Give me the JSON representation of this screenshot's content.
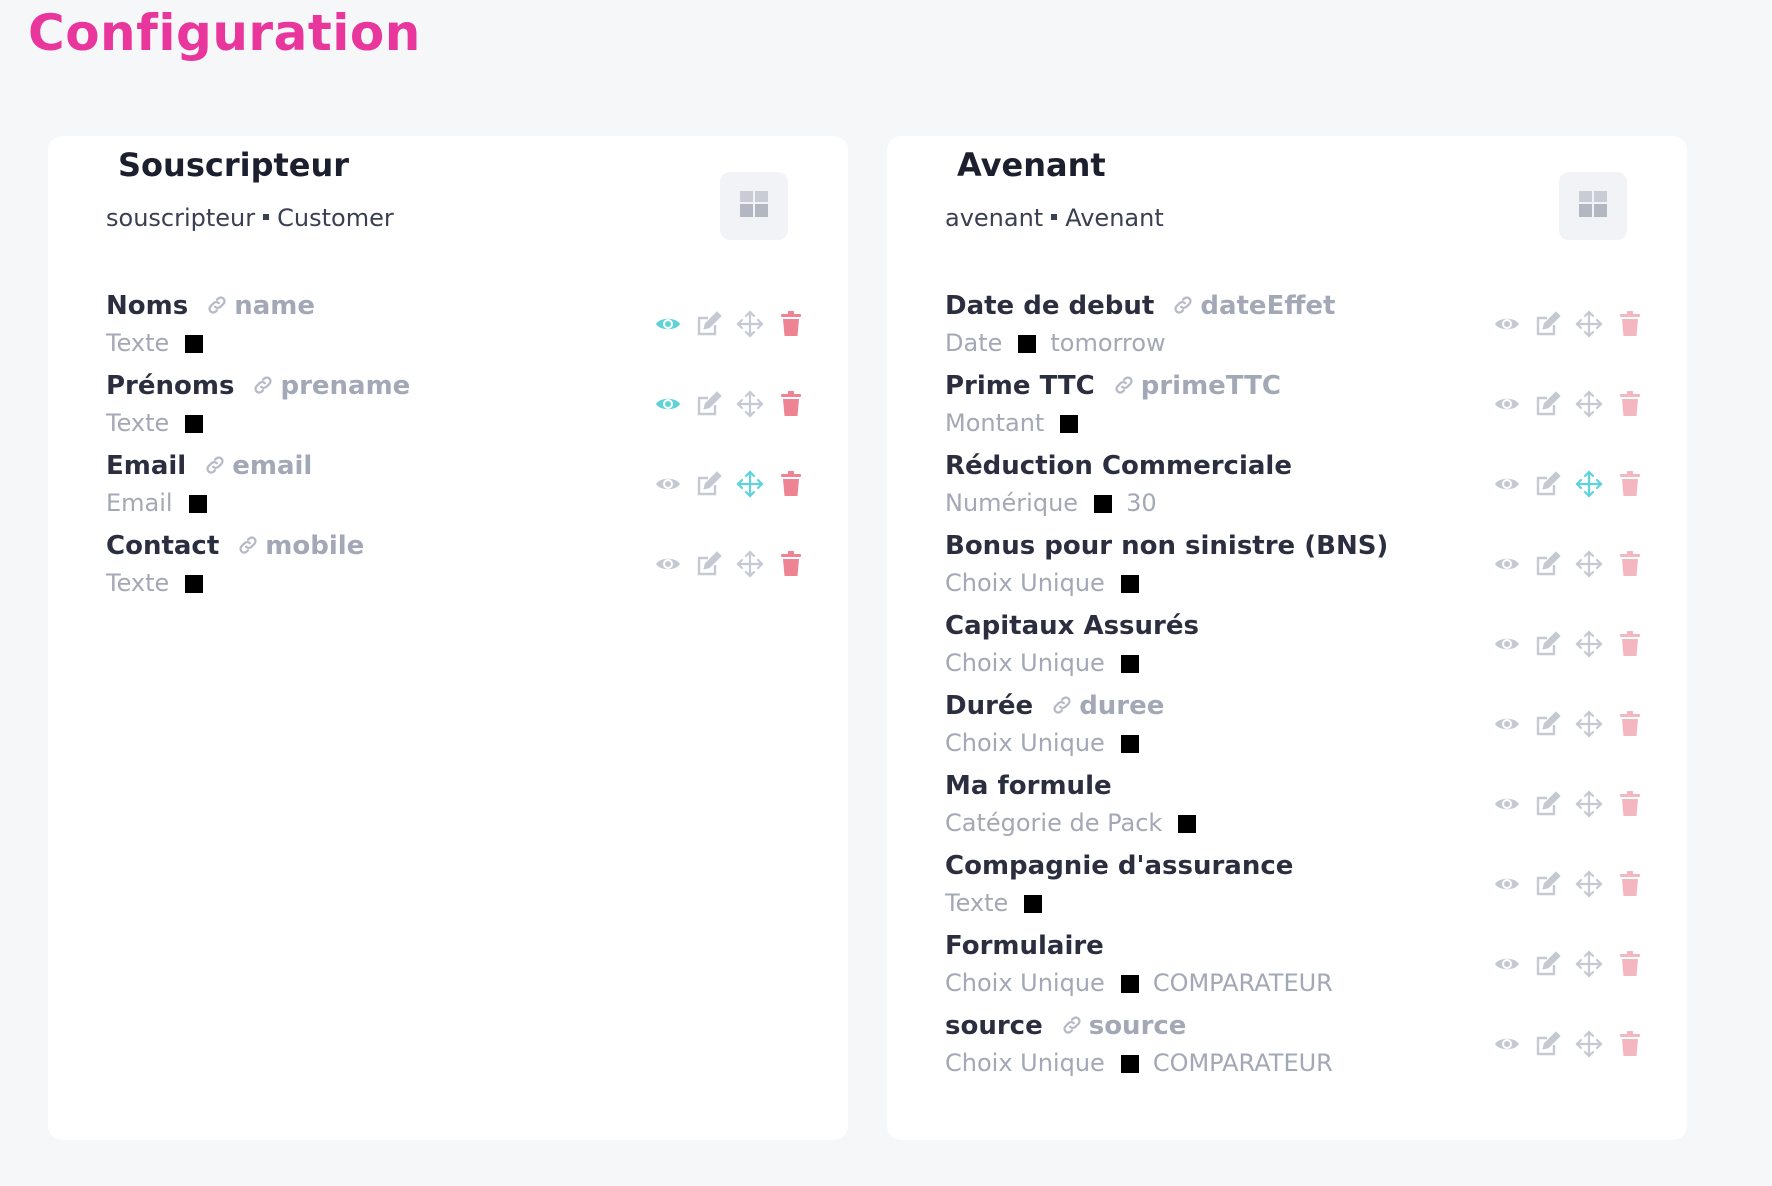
{
  "page_title": "Configuration",
  "colors": {
    "accent": "#e8369c",
    "active_teal": "#5fd2dc",
    "muted_icon": "#c5c9d3",
    "delete_active": "#ee8493",
    "delete_muted": "#f4b6c0"
  },
  "cards": [
    {
      "title": "Souscripteur",
      "key": "souscripteur",
      "entity": "Customer",
      "fields": [
        {
          "name": "Noms",
          "link": "name",
          "type": "Texte",
          "value": "",
          "eye_active": true,
          "move_active": false,
          "delete_strong": true
        },
        {
          "name": "Prénoms",
          "link": "prename",
          "type": "Texte",
          "value": "",
          "eye_active": true,
          "move_active": false,
          "delete_strong": true
        },
        {
          "name": "Email",
          "link": "email",
          "type": "Email",
          "value": "",
          "eye_active": false,
          "move_active": true,
          "delete_strong": true
        },
        {
          "name": "Contact",
          "link": "mobile",
          "type": "Texte",
          "value": "",
          "eye_active": false,
          "move_active": false,
          "delete_strong": true
        }
      ]
    },
    {
      "title": "Avenant",
      "key": "avenant",
      "entity": "Avenant",
      "fields": [
        {
          "name": "Date de debut",
          "link": "dateEffet",
          "type": "Date",
          "value": "tomorrow",
          "eye_active": false,
          "move_active": false,
          "delete_strong": false
        },
        {
          "name": "Prime TTC",
          "link": "primeTTC",
          "type": "Montant",
          "value": "",
          "eye_active": false,
          "move_active": false,
          "delete_strong": false
        },
        {
          "name": "Réduction Commerciale",
          "link": "",
          "type": "Numérique",
          "value": "30",
          "eye_active": false,
          "move_active": true,
          "delete_strong": false
        },
        {
          "name": "Bonus pour non sinistre (BNS)",
          "link": "",
          "type": "Choix Unique",
          "value": "",
          "eye_active": false,
          "move_active": false,
          "delete_strong": false
        },
        {
          "name": "Capitaux Assurés",
          "link": "",
          "type": "Choix Unique",
          "value": "",
          "eye_active": false,
          "move_active": false,
          "delete_strong": false
        },
        {
          "name": "Durée",
          "link": "duree",
          "type": "Choix Unique",
          "value": "",
          "eye_active": false,
          "move_active": false,
          "delete_strong": false
        },
        {
          "name": "Ma formule",
          "link": "",
          "type": "Catégorie de Pack",
          "value": "",
          "eye_active": false,
          "move_active": false,
          "delete_strong": false
        },
        {
          "name": "Compagnie d'assurance",
          "link": "",
          "type": "Texte",
          "value": "",
          "eye_active": false,
          "move_active": false,
          "delete_strong": false
        },
        {
          "name": "Formulaire",
          "link": "",
          "type": "Choix Unique",
          "value": "COMPARATEUR",
          "eye_active": false,
          "move_active": false,
          "delete_strong": false
        },
        {
          "name": "source",
          "link": "source",
          "type": "Choix Unique",
          "value": "COMPARATEUR",
          "eye_active": false,
          "move_active": false,
          "delete_strong": false
        }
      ]
    }
  ]
}
